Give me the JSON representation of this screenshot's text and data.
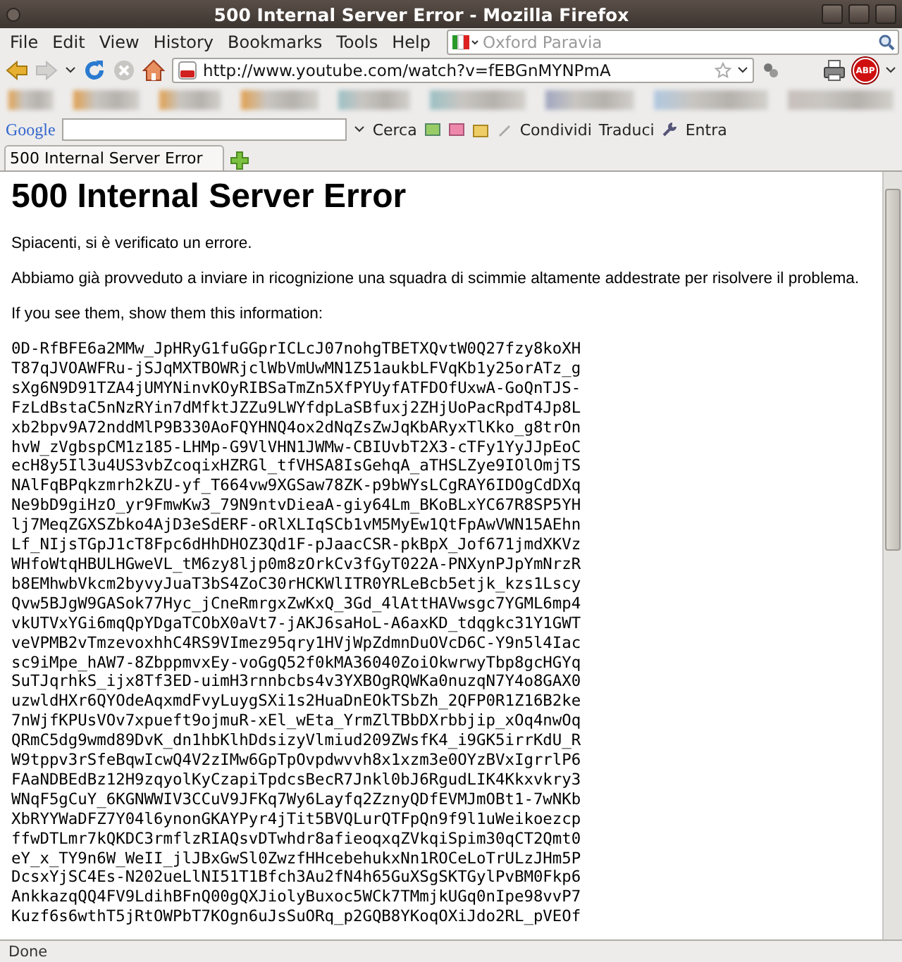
{
  "window": {
    "title": "500 Internal Server Error - Mozilla Firefox"
  },
  "menu": [
    {
      "label": "File"
    },
    {
      "label": "Edit"
    },
    {
      "label": "View"
    },
    {
      "label": "History"
    },
    {
      "label": "Bookmarks"
    },
    {
      "label": "Tools"
    },
    {
      "label": "Help"
    }
  ],
  "search": {
    "placeholder": "Oxford Paravia"
  },
  "nav": {
    "url": "http://www.youtube.com/watch?v=fEBGnMYNPmA",
    "forward_disabled": true,
    "stop_disabled": true,
    "adblock": "ABP"
  },
  "google_toolbar": {
    "logo": "Google",
    "items": [
      {
        "label": "Cerca"
      },
      {
        "label": "Condividi"
      },
      {
        "label": "Traduci"
      },
      {
        "label": "Entra"
      }
    ]
  },
  "tabs": [
    {
      "label": "500 Internal Server Error",
      "selected": true
    }
  ],
  "page": {
    "heading": "500 Internal Server Error",
    "paragraphs": [
      "Spiacenti, si è verificato un errore.",
      "Abbiamo già provveduto a inviare in ricognizione una squadra di scimmie altamente addestrate per risolvere il problema.",
      "If you see them, show them this information:"
    ],
    "code_lines": [
      "0D-RfBFE6a2MMw_JpHRyG1fuGGprICLcJ07nohgTBETXQvtW0Q27fzy8koXH",
      "T87qJVOAWFRu-jSJqMXTBOWRjclWbVmUwMN1Z51aukbLFVqKb1y25orATz_g",
      "sXg6N9D91TZA4jUMYNinvKOyRIBSaTmZn5XfPYUyfATFDOfUxwA-GoQnTJS-",
      "FzLdBstaC5nNzRYin7dMfktJZZu9LWYfdpLaSBfuxj2ZHjUoPacRpdT4Jp8L",
      "xb2bpv9A72nddMlP9B330AoFQYHNQ4ox2dNqZsZwJqKbARyxTlKko_g8trOn",
      "hvW_zVgbspCM1z185-LHMp-G9VlVHN1JWMw-CBIUvbT2X3-cTFy1YyJJpEoC",
      "ecH8y5Il3u4US3vbZcoqixHZRGl_tfVHSA8IsGehqA_aTHSLZye9IOlOmjTS",
      "NAlFqBPqkzmrh2kZU-yf_T664vw9XGSaw78ZK-p9bWYsLCgRAY6IDOgCdDXq",
      "Ne9bD9giHzO_yr9FmwKw3_79N9ntvDieaA-giy64Lm_BKoBLxYC67R8SP5YH",
      "lj7MeqZGXSZbko4AjD3eSdERF-oRlXLIqSCb1vM5MyEw1QtFpAwVWN15AEhn",
      "Lf_NIjsTGpJ1cT8Fpc6dHhDHOZ3Qd1F-pJaacCSR-pkBpX_Jof671jmdXKVz",
      "WHfoWtqHBULHGweVL_tM6zy8ljp0m8zOrkCv3fGyT022A-PNXynPJpYmNrzR",
      "b8EMhwbVkcm2byvyJuaT3bS4ZoC30rHCKWlITR0YRLeBcb5etjk_kzs1Lscy",
      "Qvw5BJgW9GASok77Hyc_jCneRmrgxZwKxQ_3Gd_4lAttHAVwsgc7YGML6mp4",
      "vkUTVxYGi6mqQpYDgaTCObX0aVt7-jAKJ6saHoL-A6axKD_tdqgkc31Y1GWT",
      "veVPMB2vTmzevoxhhC4RS9VImez95qry1HVjWpZdmnDuOVcD6C-Y9n5l4Iac",
      "sc9iMpe_hAW7-8ZbppmvxEy-voGgQ52f0kMA36040ZoiOkwrwyTbp8gcHGYq",
      "SuTJqrhkS_ijx8Tf3ED-uimH3rnnbcbs4v3YXBOgRQWKa0nuzqN7Y4o8GAX0",
      "uzwldHXr6QYOdeAqxmdFvyLuygSXi1s2HuaDnEOkTSbZh_2QFP0R1Z16B2ke",
      "7nWjfKPUsVOv7xpueft9ojmuR-xEl_wEta_YrmZlTBbDXrbbjip_xOq4nwOq",
      "QRmC5dg9wmd89DvK_dn1hbKlhDdsizyVlmiud209ZWsfK4_i9GK5irrKdU_R",
      "W9tppv3rSfeBqwIcwQ4V2zIMw6GpTpOvpdwvvh8x1xzm3e0OYzBVxIgrrlP6",
      "FAaNDBEdBz12H9zqyolKyCzapiTpdcsBecR7Jnkl0bJ6RgudLIK4Kkxvkry3",
      "WNqF5gCuY_6KGNWWIV3CCuV9JFKq7Wy6Layfq2ZznyQDfEVMJmOBt1-7wNKb",
      "XbRYYWaDFZ7Y04l6ynonGKAYPyr4jTit5BVQLurQTFpQn9f9l1uWeikoezcp",
      "ffwDTLmr7kQKDC3rmflzRIAQsvDTwhdr8afieoqxqZVkqiSpim30qCT2Qmt0",
      "eY_x_TY9n6W_WeII_jlJBxGwSl0ZwzfHHcebehukxNn1ROCeLoTrULzJHm5P",
      "DcsxYjSC4Es-N202ueLlNI51T1Bfch3Au2fN4h65GuXSgSKTGylPvBM0Fkp6",
      "AnkkazqQQ4FV9LdihBFnQ00gQXJiolyBuxoc5WCk7TMmjkUGq0nIpe98vvP7",
      "Kuzf6s6wthT5jRtOWPbT7KOgn6uJsSuORq_p2GQB8YKoqOXiJdo2RL_pVEOf"
    ]
  },
  "status_bar": {
    "text": "Done"
  }
}
